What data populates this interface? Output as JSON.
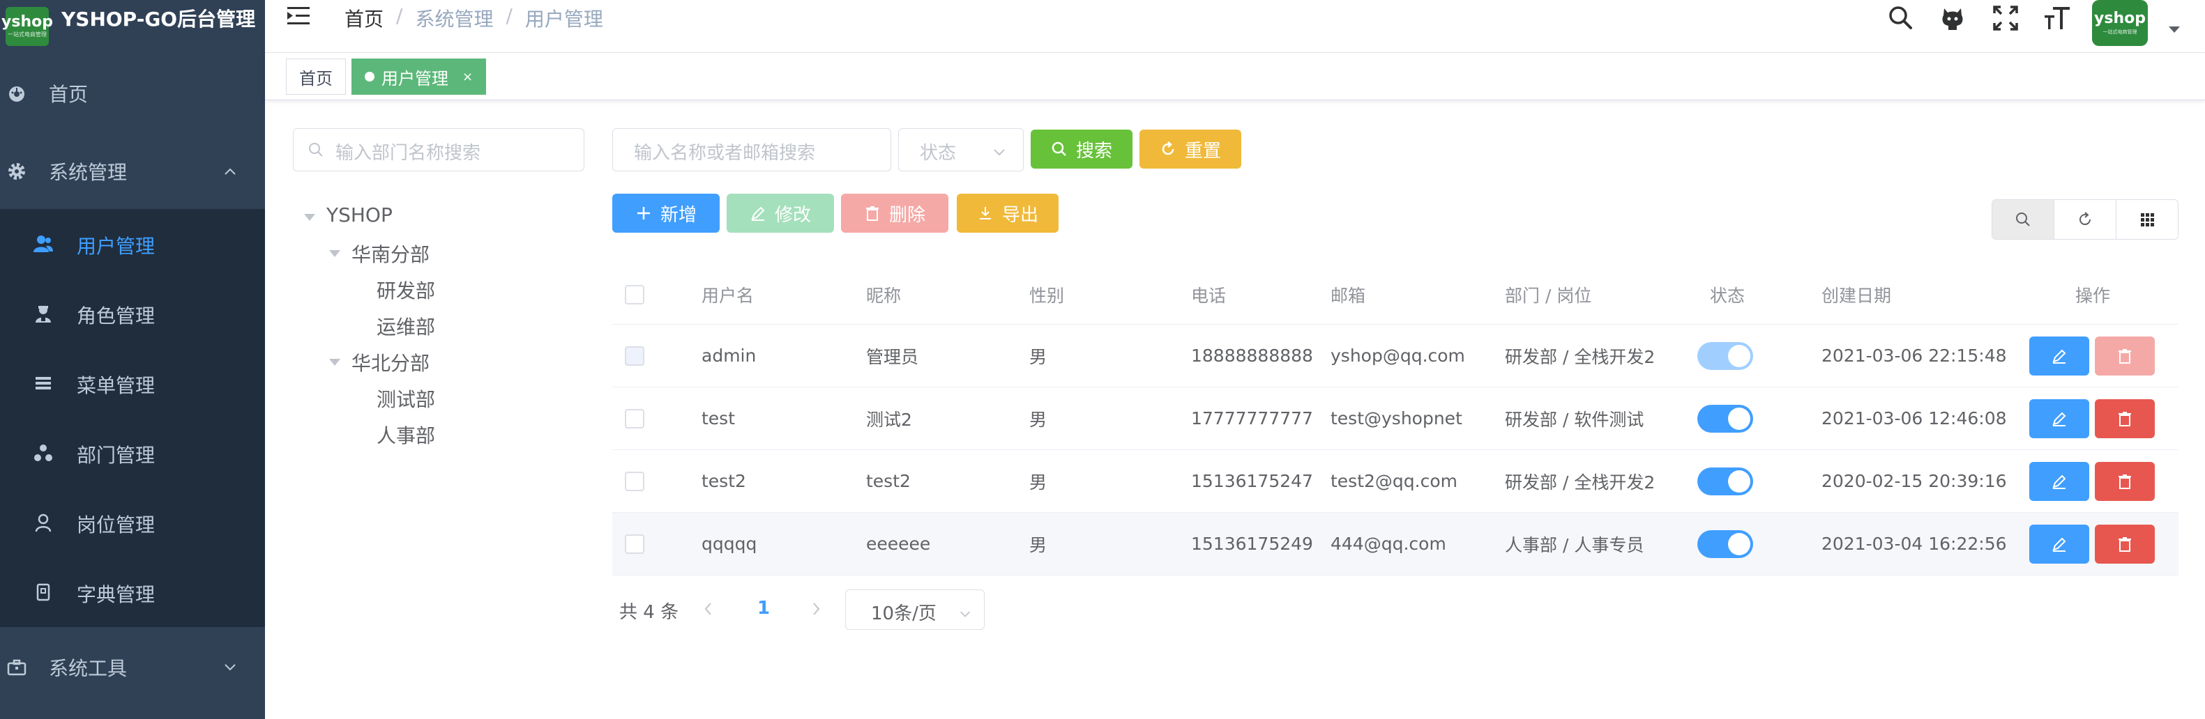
{
  "app": {
    "logo_text": "yshop",
    "logo_sub": "一站式电商管理",
    "title": "YSHOP-GO后台管理"
  },
  "sidebar": {
    "items": [
      {
        "label": "首页",
        "icon": "dashboard-icon"
      },
      {
        "label": "系统管理",
        "icon": "gear-icon",
        "expanded": true
      },
      {
        "label": "系统工具",
        "icon": "toolbox-icon",
        "expanded": false
      }
    ],
    "sub_items": [
      {
        "label": "用户管理",
        "icon": "user-icon",
        "active": true
      },
      {
        "label": "角色管理",
        "icon": "role-icon"
      },
      {
        "label": "菜单管理",
        "icon": "menu-icon"
      },
      {
        "label": "部门管理",
        "icon": "department-icon"
      },
      {
        "label": "岗位管理",
        "icon": "post-icon"
      },
      {
        "label": "字典管理",
        "icon": "dictionary-icon"
      }
    ]
  },
  "header": {
    "breadcrumb": [
      "首页",
      "系统管理",
      "用户管理"
    ],
    "sep": "/",
    "avatar_text": "yshop",
    "avatar_sub": "一站式电商管理"
  },
  "tags": [
    {
      "label": "首页",
      "active": false
    },
    {
      "label": "用户管理",
      "active": true,
      "close": "×"
    }
  ],
  "dept_tree": {
    "search_placeholder": "输入部门名称搜索",
    "nodes": [
      {
        "label": "YSHOP",
        "level": 0
      },
      {
        "label": "华南分部",
        "level": 1
      },
      {
        "label": "研发部",
        "level": 2
      },
      {
        "label": "运维部",
        "level": 2
      },
      {
        "label": "华北分部",
        "level": 1
      },
      {
        "label": "测试部",
        "level": 2
      },
      {
        "label": "人事部",
        "level": 2
      }
    ]
  },
  "filters": {
    "keyword_placeholder": "输入名称或者邮箱搜索",
    "status_placeholder": "状态",
    "search_label": "搜索",
    "reset_label": "重置"
  },
  "toolbar": {
    "add_label": "新增",
    "edit_label": "修改",
    "delete_label": "删除",
    "export_label": "导出"
  },
  "table": {
    "columns": [
      "用户名",
      "昵称",
      "性别",
      "电话",
      "邮箱",
      "部门 / 岗位",
      "状态",
      "创建日期",
      "操作"
    ],
    "rows": [
      {
        "username": "admin",
        "nickname": "管理员",
        "sex": "男",
        "phone": "18888888888",
        "email": "yshop@qq.com",
        "dept": "研发部 / 全栈开发2",
        "enabled": true,
        "created": "2021-03-06 22:15:48"
      },
      {
        "username": "test",
        "nickname": "测试2",
        "sex": "男",
        "phone": "17777777777",
        "email": "test@yshopnet",
        "dept": "研发部 / 软件测试",
        "enabled": true,
        "created": "2021-03-06 12:46:08"
      },
      {
        "username": "test2",
        "nickname": "test2",
        "sex": "男",
        "phone": "15136175247",
        "email": "test2@qq.com",
        "dept": "研发部 / 全栈开发2",
        "enabled": true,
        "created": "2020-02-15 20:39:16"
      },
      {
        "username": "qqqqq",
        "nickname": "eeeeee",
        "sex": "男",
        "phone": "15136175249",
        "email": "444@qq.com",
        "dept": "人事部 / 人事专员",
        "enabled": true,
        "created": "2021-03-04 16:22:56"
      }
    ]
  },
  "pagination": {
    "total_text": "共 4 条",
    "current_page": "1",
    "page_size": "10条/页"
  },
  "colors": {
    "primary": "#409eff",
    "success": "#67c23a",
    "warning": "#f0b93a",
    "danger": "#e8574f",
    "sidebar_bg": "#304156",
    "submenu_bg": "#1f2d3d",
    "tag_active": "#5cb87a"
  }
}
